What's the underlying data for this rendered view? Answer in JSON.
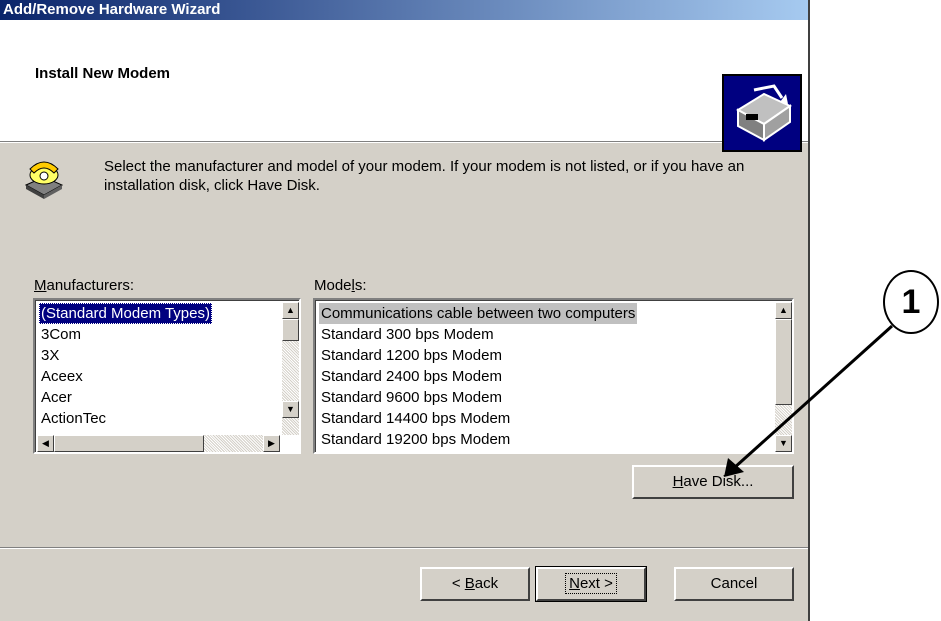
{
  "window": {
    "title": "Add/Remove Hardware Wizard"
  },
  "header": {
    "title": "Install New Modem",
    "icon": "hardware-wizard-icon"
  },
  "intro": {
    "icon": "telephone-modem-icon",
    "text": "Select the manufacturer and model of your modem. If your modem is not listed, or if you have an installation disk, click Have Disk."
  },
  "manufacturers": {
    "label_accel": "M",
    "label_rest": "anufacturers:",
    "items": [
      "(Standard Modem Types)",
      "3Com",
      "3X",
      "Aceex",
      "Acer",
      "ActionTec"
    ],
    "selected_index": 0
  },
  "models": {
    "label_pre": "Mode",
    "label_accel": "l",
    "label_post": "s:",
    "items": [
      "Communications cable between two computers",
      "Standard   300 bps Modem",
      "Standard  1200 bps Modem",
      "Standard  2400 bps Modem",
      "Standard  9600 bps Modem",
      "Standard 14400 bps Modem",
      "Standard 19200 bps Modem"
    ],
    "selected_index": 0
  },
  "buttons": {
    "have_disk_accel": "H",
    "have_disk_rest": "ave Disk...",
    "back_pre": "< ",
    "back_accel": "B",
    "back_rest": "ack",
    "next_accel": "N",
    "next_rest": "ext >",
    "cancel": "Cancel"
  },
  "annotation": {
    "callout_number": "1"
  },
  "colors": {
    "titlebar_start": "#0a246a",
    "titlebar_end": "#a6caf0",
    "face": "#d4d0c8",
    "selection": "#000080"
  }
}
